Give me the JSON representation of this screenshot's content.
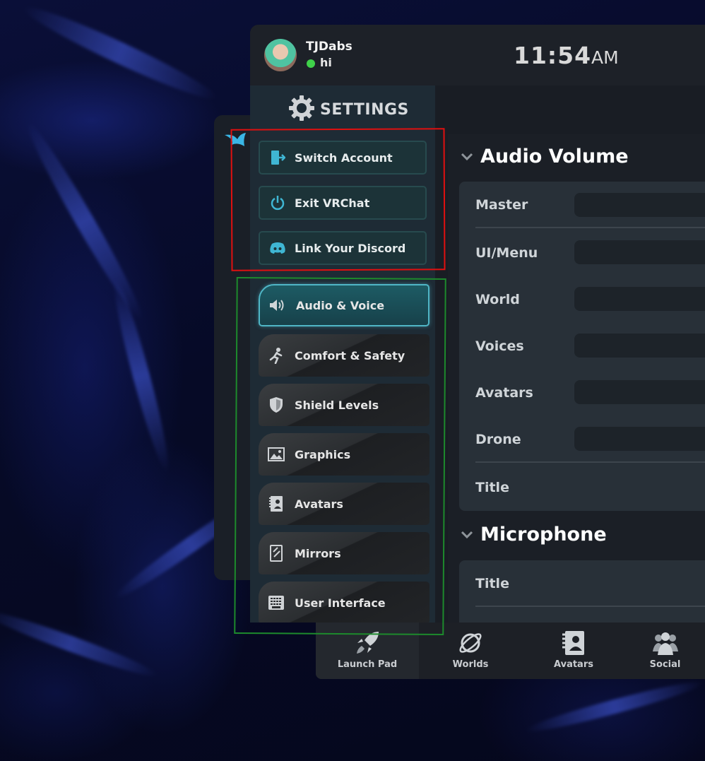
{
  "user": {
    "name": "TJDabs",
    "status": "hi",
    "status_color": "#3fd14a"
  },
  "clock": {
    "time": "11:54",
    "ampm": "AM"
  },
  "sidebar": {
    "title": "SETTINGS",
    "account_buttons": [
      {
        "label": "Switch Account",
        "icon": "door-exit-icon"
      },
      {
        "label": "Exit VRChat",
        "icon": "power-icon"
      },
      {
        "label": "Link Your Discord",
        "icon": "discord-icon"
      }
    ],
    "menu_items": [
      {
        "label": "Audio & Voice",
        "icon": "speaker-icon",
        "active": true
      },
      {
        "label": "Comfort & Safety",
        "icon": "running-person-icon"
      },
      {
        "label": "Shield Levels",
        "icon": "shield-icon"
      },
      {
        "label": "Graphics",
        "icon": "image-icon"
      },
      {
        "label": "Avatars",
        "icon": "avatar-card-icon"
      },
      {
        "label": "Mirrors",
        "icon": "mirror-icon"
      },
      {
        "label": "User Interface",
        "icon": "keyboard-icon"
      }
    ]
  },
  "content": {
    "audio_section": {
      "title": "Audio Volume",
      "rows": [
        "Master",
        "UI/Menu",
        "World",
        "Voices",
        "Avatars",
        "Drone",
        "Title"
      ]
    },
    "mic_section": {
      "title": "Microphone",
      "rows": [
        "Title"
      ]
    }
  },
  "footer": {
    "tabs": [
      {
        "label": "Launch Pad",
        "icon": "rocket-icon"
      },
      {
        "label": "Worlds",
        "icon": "planet-icon"
      },
      {
        "label": "Avatars",
        "icon": "avatar-card-icon"
      },
      {
        "label": "Social",
        "icon": "people-icon"
      }
    ]
  },
  "colors": {
    "accent": "#4fb6c6",
    "annotation_red": "#e01010",
    "annotation_green": "#1d8a2c"
  }
}
